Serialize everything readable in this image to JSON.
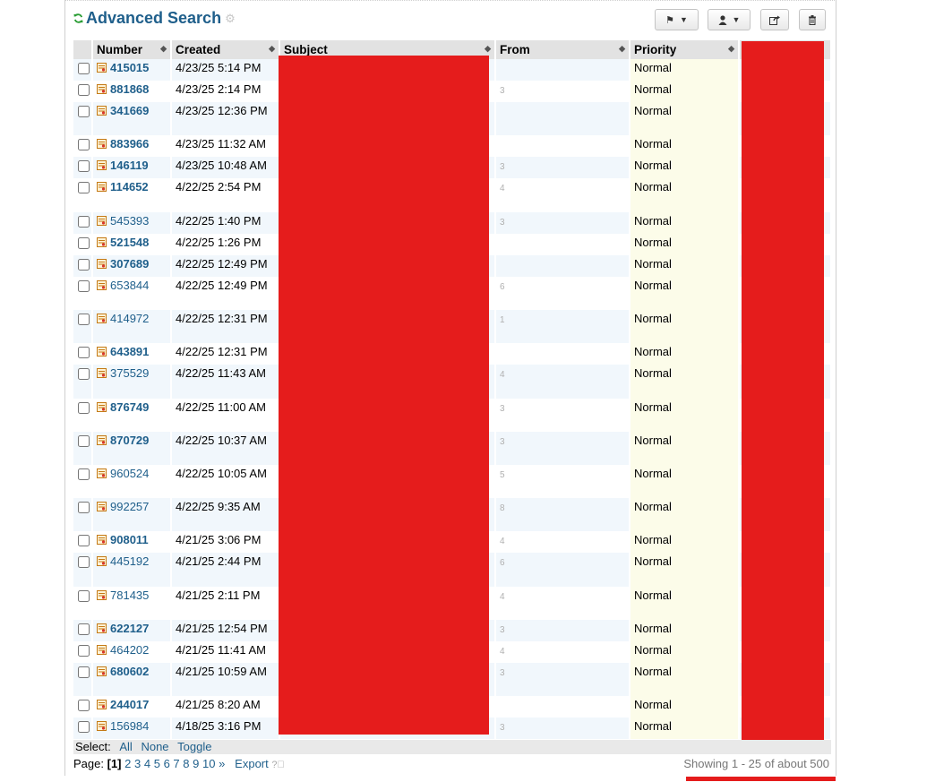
{
  "title": "Advanced Search",
  "columns": {
    "number": "Number",
    "created": "Created",
    "subject": "Subject",
    "from": "From",
    "priority": "Priority"
  },
  "rows": [
    {
      "num": "415015",
      "bold": true,
      "created": "4/23/25 5:14 PM",
      "from": "",
      "priority": "Normal",
      "h": 24
    },
    {
      "num": "881868",
      "bold": true,
      "created": "4/23/25 2:14 PM",
      "from": "3",
      "priority": "Normal",
      "h": 24
    },
    {
      "num": "341669",
      "bold": true,
      "created": "4/23/25 12:36 PM",
      "from": "",
      "priority": "Normal",
      "h": 37
    },
    {
      "num": "883966",
      "bold": true,
      "created": "4/23/25 11:32 AM",
      "from": "",
      "priority": "Normal",
      "h": 24
    },
    {
      "num": "146119",
      "bold": true,
      "created": "4/23/25 10:48 AM",
      "from": "3",
      "priority": "Normal",
      "h": 24
    },
    {
      "num": "114652",
      "bold": true,
      "created": "4/22/25 2:54 PM",
      "from": "4",
      "priority": "Normal",
      "h": 38
    },
    {
      "num": "545393",
      "bold": false,
      "created": "4/22/25 1:40 PM",
      "from": "3",
      "priority": "Normal",
      "h": 24
    },
    {
      "num": "521548",
      "bold": true,
      "created": "4/22/25 1:26 PM",
      "from": "",
      "priority": "Normal",
      "h": 24
    },
    {
      "num": "307689",
      "bold": true,
      "created": "4/22/25 12:49 PM",
      "from": "",
      "priority": "Normal",
      "h": 24
    },
    {
      "num": "653844",
      "bold": false,
      "created": "4/22/25 12:49 PM",
      "from": "6",
      "priority": "Normal",
      "h": 37
    },
    {
      "num": "414972",
      "bold": false,
      "created": "4/22/25 12:31 PM",
      "from": "1",
      "priority": "Normal",
      "h": 37
    },
    {
      "num": "643891",
      "bold": true,
      "created": "4/22/25 12:31 PM",
      "from": "",
      "priority": "Normal",
      "h": 24
    },
    {
      "num": "375529",
      "bold": false,
      "created": "4/22/25 11:43 AM",
      "from": "4",
      "priority": "Normal",
      "h": 38
    },
    {
      "num": "876749",
      "bold": true,
      "created": "4/22/25 11:00 AM",
      "from": "3",
      "priority": "Normal",
      "h": 37
    },
    {
      "num": "870729",
      "bold": true,
      "created": "4/22/25 10:37 AM",
      "from": "3",
      "priority": "Normal",
      "h": 37
    },
    {
      "num": "960524",
      "bold": false,
      "created": "4/22/25 10:05 AM",
      "from": "5",
      "priority": "Normal",
      "h": 37
    },
    {
      "num": "992257",
      "bold": false,
      "created": "4/22/25 9:35 AM",
      "from": "8",
      "priority": "Normal",
      "h": 37
    },
    {
      "num": "908011",
      "bold": true,
      "created": "4/21/25 3:06 PM",
      "from": "4",
      "priority": "Normal",
      "h": 24
    },
    {
      "num": "445192",
      "bold": false,
      "created": "4/21/25 2:44 PM",
      "from": "6",
      "priority": "Normal",
      "h": 38
    },
    {
      "num": "781435",
      "bold": false,
      "created": "4/21/25 2:11 PM",
      "from": "4",
      "priority": "Normal",
      "h": 37
    },
    {
      "num": "622127",
      "bold": true,
      "created": "4/21/25 12:54 PM",
      "from": "3",
      "priority": "Normal",
      "h": 24
    },
    {
      "num": "464202",
      "bold": false,
      "created": "4/21/25 11:41 AM",
      "from": "4",
      "priority": "Normal",
      "h": 24
    },
    {
      "num": "680602",
      "bold": true,
      "created": "4/21/25 10:59 AM",
      "from": "3",
      "priority": "Normal",
      "h": 37
    },
    {
      "num": "244017",
      "bold": true,
      "created": "4/21/25 8:20 AM",
      "from": "",
      "priority": "Normal",
      "h": 24
    },
    {
      "num": "156984",
      "bold": false,
      "created": "4/18/25 3:16 PM",
      "from": "3",
      "priority": "Normal",
      "h": 24
    }
  ],
  "select": {
    "label": "Select:",
    "all": "All",
    "none": "None",
    "toggle": "Toggle"
  },
  "pager": {
    "label": "Page:",
    "current": "[1]",
    "pages": [
      "2",
      "3",
      "4",
      "5",
      "6",
      "7",
      "8",
      "9",
      "10"
    ],
    "next": "»",
    "export": "Export"
  },
  "showing": "Showing 1 - 25 of about 500",
  "colors": {
    "link": "#1f5f8b",
    "redaction": "#e51c1c",
    "row_alt": "#f1f7fc",
    "priority_bg": "#fcfce9"
  }
}
